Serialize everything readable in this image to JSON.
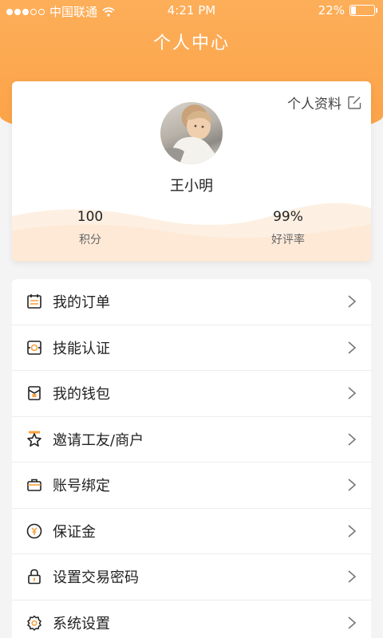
{
  "status_bar": {
    "carrier": "中国联通",
    "time": "4:21 PM",
    "battery": "22%",
    "battery_level": 0.22
  },
  "page_title": "个人中心",
  "profile": {
    "edit_label": "个人资料",
    "name": "王小明",
    "stats": [
      {
        "value": "100",
        "label": "积分"
      },
      {
        "value": "99%",
        "label": "好评率"
      }
    ]
  },
  "menu": {
    "items": [
      {
        "label": "我的订单",
        "icon": "calendar-icon"
      },
      {
        "label": "技能认证",
        "icon": "certificate-icon"
      },
      {
        "label": "我的钱包",
        "icon": "wallet-icon"
      },
      {
        "label": "邀请工友/商户",
        "icon": "star-icon"
      },
      {
        "label": "账号绑定",
        "icon": "briefcase-icon"
      },
      {
        "label": "保证金",
        "icon": "deposit-icon"
      },
      {
        "label": "设置交易密码",
        "icon": "lock-icon"
      },
      {
        "label": "系统设置",
        "icon": "gear-icon"
      }
    ]
  },
  "colors": {
    "accent": "#fba247",
    "icon_accent": "#f7a140"
  }
}
